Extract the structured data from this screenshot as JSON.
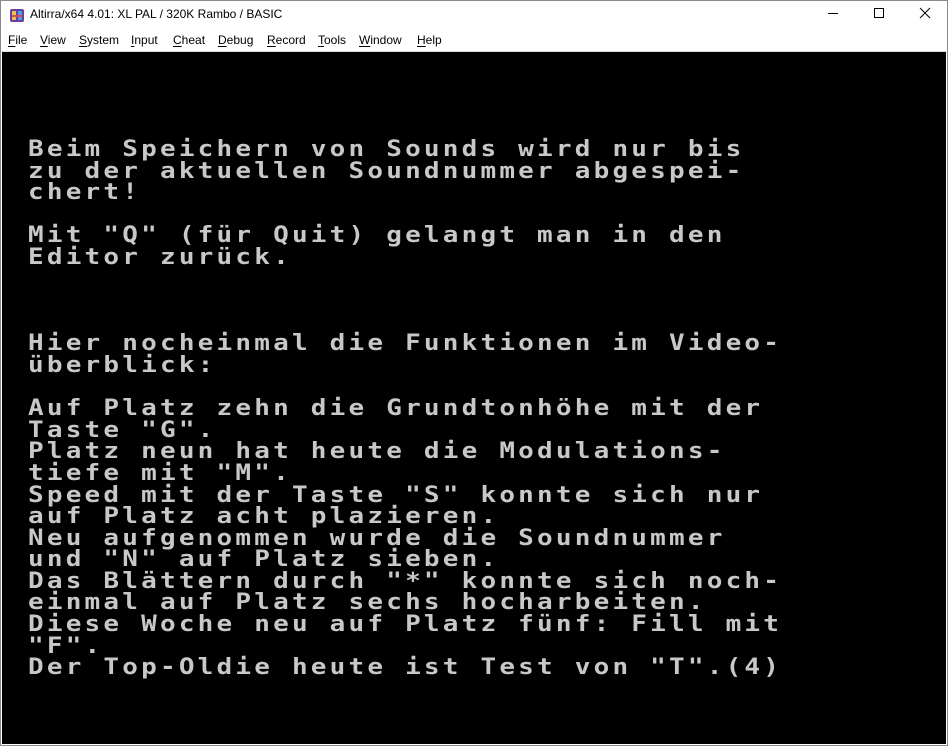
{
  "window": {
    "title": "Altirra/x64 4.01: XL PAL / 320K Rambo / BASIC",
    "app_icon": "altirra-app-icon",
    "controls": {
      "minimize": "minimize-icon",
      "maximize": "maximize-icon",
      "close": "close-icon"
    }
  },
  "menu": {
    "items": [
      {
        "label": "File"
      },
      {
        "label": "View"
      },
      {
        "label": "System"
      },
      {
        "label": "Input"
      },
      {
        "label": "Cheat"
      },
      {
        "label": "Debug"
      },
      {
        "label": "Record"
      },
      {
        "label": "Tools"
      },
      {
        "label": "Window"
      },
      {
        "label": "Help"
      }
    ]
  },
  "screen": {
    "background": "#000000",
    "text_color": "#c8c8c8",
    "lines": [
      "Beim Speichern von Sounds wird nur bis",
      "zu der aktuellen Soundnummer abgespei-",
      "chert!",
      "",
      "Mit \"Q\" (für Quit) gelangt man in den",
      "Editor zurück.",
      "",
      "",
      "",
      "Hier nocheinmal die Funktionen im Video-",
      "überblick:",
      "",
      "Auf Platz zehn die Grundtonhöhe mit der",
      "Taste \"G\".",
      "Platz neun hat heute die Modulations-",
      "tiefe mit \"M\".",
      "Speed mit der Taste \"S\" konnte sich nur",
      "auf Platz acht plazieren.",
      "Neu aufgenommen wurde die Soundnummer",
      "und \"N\" auf Platz sieben.",
      "Das Blättern durch \"*\" konnte sich noch-",
      "einmal auf Platz sechs hocharbeiten.",
      "Diese Woche neu auf Platz fünf: Fill mit",
      "\"F\".",
      "Der Top-Oldie heute ist Test von \"T\".(4)"
    ]
  }
}
